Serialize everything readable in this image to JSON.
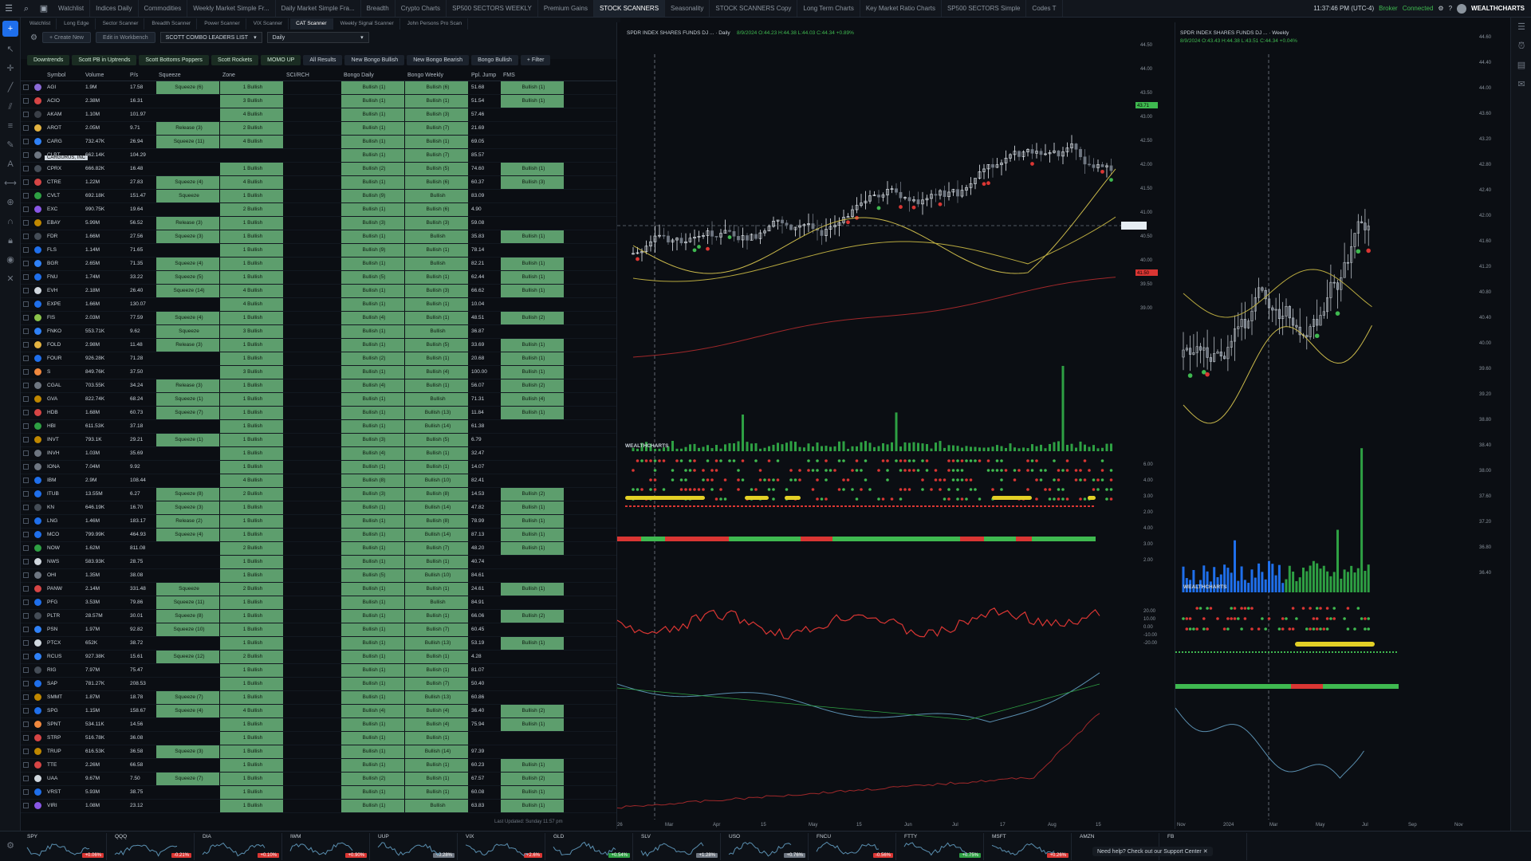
{
  "tabs": [
    "Watchlist",
    "Indices Daily",
    "Commodities",
    "Weekly Market Simple Fr...",
    "Daily Market Simple Fra...",
    "Breadth",
    "Crypto Charts",
    "SP500 SECTORS WEEKLY",
    "Premium Gains",
    "STOCK SCANNERS",
    "Seasonality",
    "STOCK SCANNERS Copy",
    "Long Term Charts",
    "Key Market Ratio Charts",
    "SP500 SECTORS Simple",
    "Codes T"
  ],
  "active_tab": "STOCK SCANNERS",
  "subtabs": [
    "Watchlist",
    "Long Edge",
    "Sector Scanner",
    "Breadth Scanner",
    "Power Scanner",
    "VIX Scanner",
    "CAT Scanner",
    "Weekly Signal Scanner",
    "John Persons Pro Scan"
  ],
  "status": {
    "time": "11:37:46 PM (UTC-4)",
    "broker": "Broker",
    "connected": "Connected",
    "brand": "WEALTHCHARTS"
  },
  "ws": {
    "btn1": "+ Create New",
    "btn2": "Edit in Workbench",
    "watchlist": "SCOTT COMBO LEADERS LIST",
    "interval": "Daily"
  },
  "filters": [
    "Downtrends",
    "Scott PB in Uptrends",
    "Scott Bottoms Poppers",
    "Scott Rockets",
    "MOMO UP",
    "All Results",
    "New Bongo Bullish",
    "New Bongo Bearish",
    "Bongo Bullish",
    "+ Filter"
  ],
  "columns": [
    "Symbol",
    "Volume",
    "P/s",
    "Squeeze",
    "Zone",
    "SCI/RCH",
    "Bongo Daily",
    "Bongo Weekly",
    "Ppl. Jump",
    "FMS"
  ],
  "tooltip": "CARGURUS, INC",
  "rows": [
    {
      "s": "AGI",
      "v": "1.9M",
      "p": "17.58",
      "q": "Squeeze (6)",
      "z": "1 Bullish",
      "d": "Bullish (1)",
      "w": "Bullish (6)",
      "j": "51.68",
      "f": "Bullish (1)",
      "c": "#8b6bd6"
    },
    {
      "s": "ACIO",
      "v": "2.38M",
      "p": "16.31",
      "q": "",
      "z": "3 Bullish",
      "d": "Bullish (1)",
      "w": "Bullish (1)",
      "j": "51.54",
      "f": "Bullish (1)",
      "c": "#d64545"
    },
    {
      "s": "AKAM",
      "v": "1.10M",
      "p": "101.97",
      "q": "",
      "z": "4 Bullish",
      "d": "Bullish (1)",
      "w": "Bullish (3)",
      "j": "57.46",
      "f": "",
      "c": "#3a3f47"
    },
    {
      "s": "AROT",
      "v": "2.05M",
      "p": "9.71",
      "q": "Release (3)",
      "z": "2 Bullish",
      "d": "Bullish (1)",
      "w": "Bullish (7)",
      "j": "21.69",
      "f": "",
      "c": "#e3b341"
    },
    {
      "s": "CARG",
      "v": "732.47K",
      "p": "26.94",
      "q": "Squeeze (11)",
      "z": "4 Bullish",
      "d": "Bullish (1)",
      "w": "Bullish (1)",
      "j": "69.05",
      "f": "",
      "c": "#2f81f7"
    },
    {
      "s": "CLBT",
      "v": "662.14K",
      "p": "104.29",
      "q": "",
      "z": "",
      "d": "Bullish (1)",
      "w": "Bullish (7)",
      "j": "85.57",
      "f": "",
      "c": "#6e7681"
    },
    {
      "s": "CPRX",
      "v": "666.82K",
      "p": "16.48",
      "q": "",
      "z": "1 Bullish",
      "d": "Bullish (2)",
      "w": "Bullish (5)",
      "j": "74.60",
      "f": "Bullish (1)",
      "c": "#444c56"
    },
    {
      "s": "CTRE",
      "v": "1.22M",
      "p": "27.83",
      "q": "Squeeze (4)",
      "z": "4 Bullish",
      "d": "Bullish (1)",
      "w": "Bullish (6)",
      "j": "60.37",
      "f": "Bullish (3)",
      "c": "#d64545"
    },
    {
      "s": "CVLT",
      "v": "692.18K",
      "p": "151.47",
      "q": "Squeeze",
      "z": "1 Bullish",
      "d": "Bullish (9)",
      "w": "Bullish",
      "j": "83.09",
      "f": "",
      "c": "#2ea043"
    },
    {
      "s": "EXC",
      "v": "990.75K",
      "p": "19.64",
      "q": "",
      "z": "2 Bullish",
      "d": "Bullish (1)",
      "w": "Bullish (6)",
      "j": "4.90",
      "f": "",
      "c": "#8957e5"
    },
    {
      "s": "EBAY",
      "v": "5.99M",
      "p": "56.52",
      "q": "Release (3)",
      "z": "1 Bullish",
      "d": "Bullish (3)",
      "w": "Bullish (3)",
      "j": "59.08",
      "f": "",
      "c": "#bf8700"
    },
    {
      "s": "FDR",
      "v": "1.66M",
      "p": "27.56",
      "q": "Squeeze (3)",
      "z": "1 Bullish",
      "d": "Bullish (1)",
      "w": "Bullish",
      "j": "35.83",
      "f": "Bullish (1)",
      "c": "#444c56"
    },
    {
      "s": "FLS",
      "v": "1.14M",
      "p": "71.65",
      "q": "",
      "z": "1 Bullish",
      "d": "Bullish (9)",
      "w": "Bullish (1)",
      "j": "78.14",
      "f": "",
      "c": "#1f6feb"
    },
    {
      "s": "BGR",
      "v": "2.65M",
      "p": "71.35",
      "q": "Squeeze (4)",
      "z": "1 Bullish",
      "d": "Bullish (1)",
      "w": "Bullish",
      "j": "82.21",
      "f": "Bullish (1)",
      "c": "#2f81f7"
    },
    {
      "s": "FNU",
      "v": "1.74M",
      "p": "33.22",
      "q": "Squeeze (5)",
      "z": "1 Bullish",
      "d": "Bullish (5)",
      "w": "Bullish (1)",
      "j": "62.44",
      "f": "Bullish (1)",
      "c": "#1f6feb"
    },
    {
      "s": "EVH",
      "v": "2.18M",
      "p": "26.40",
      "q": "Squeeze (14)",
      "z": "4 Bullish",
      "d": "Bullish (1)",
      "w": "Bullish (3)",
      "j": "66.62",
      "f": "Bullish (1)",
      "c": "#d0d7de"
    },
    {
      "s": "EXPE",
      "v": "1.66M",
      "p": "130.07",
      "q": "",
      "z": "4 Bullish",
      "d": "Bullish (1)",
      "w": "Bullish (1)",
      "j": "10.04",
      "f": "",
      "c": "#1f6feb"
    },
    {
      "s": "FIS",
      "v": "2.03M",
      "p": "77.59",
      "q": "Squeeze (4)",
      "z": "1 Bullish",
      "d": "Bullish (4)",
      "w": "Bullish (1)",
      "j": "48.51",
      "f": "Bullish (2)",
      "c": "#8bc34a"
    },
    {
      "s": "FNKO",
      "v": "553.71K",
      "p": "9.62",
      "q": "Squeeze",
      "z": "3 Bullish",
      "d": "Bullish (1)",
      "w": "Bullish",
      "j": "36.87",
      "f": "",
      "c": "#2f81f7"
    },
    {
      "s": "FOLD",
      "v": "2.98M",
      "p": "11.48",
      "q": "Release (3)",
      "z": "1 Bullish",
      "d": "Bullish (1)",
      "w": "Bullish (5)",
      "j": "33.69",
      "f": "Bullish (1)",
      "c": "#e3b341"
    },
    {
      "s": "FOUR",
      "v": "926.28K",
      "p": "71.28",
      "q": "",
      "z": "1 Bullish",
      "d": "Bullish (2)",
      "w": "Bullish (1)",
      "j": "20.68",
      "f": "Bullish (1)",
      "c": "#1f6feb"
    },
    {
      "s": "S",
      "v": "849.76K",
      "p": "37.50",
      "q": "",
      "z": "3 Bullish",
      "d": "Bullish (1)",
      "w": "Bullish (4)",
      "j": "100.00",
      "f": "Bullish (1)",
      "c": "#f0883e"
    },
    {
      "s": "CGAL",
      "v": "703.55K",
      "p": "34.24",
      "q": "Release (3)",
      "z": "1 Bullish",
      "d": "Bullish (4)",
      "w": "Bullish (1)",
      "j": "56.07",
      "f": "Bullish (2)",
      "c": "#6e7681"
    },
    {
      "s": "GVA",
      "v": "822.74K",
      "p": "68.24",
      "q": "Squeeze (1)",
      "z": "1 Bullish",
      "d": "Bullish (1)",
      "w": "Bullish",
      "j": "71.31",
      "f": "Bullish (4)",
      "c": "#bf8700"
    },
    {
      "s": "HDB",
      "v": "1.68M",
      "p": "60.73",
      "q": "Squeeze (7)",
      "z": "1 Bullish",
      "d": "Bullish (1)",
      "w": "Bullish (13)",
      "j": "11.84",
      "f": "Bullish (1)",
      "c": "#d64545"
    },
    {
      "s": "HBI",
      "v": "611.53K",
      "p": "37.18",
      "q": "",
      "z": "1 Bullish",
      "d": "Bullish (1)",
      "w": "Bullish (14)",
      "j": "61.38",
      "f": "",
      "c": "#2ea043"
    },
    {
      "s": "INVT",
      "v": "793.1K",
      "p": "29.21",
      "q": "Squeeze (1)",
      "z": "1 Bullish",
      "d": "Bullish (3)",
      "w": "Bullish (5)",
      "j": "6.79",
      "f": "",
      "c": "#bf8700"
    },
    {
      "s": "INVH",
      "v": "1.03M",
      "p": "35.69",
      "q": "",
      "z": "1 Bullish",
      "d": "Bullish (4)",
      "w": "Bullish (1)",
      "j": "32.47",
      "f": "",
      "c": "#6e7681"
    },
    {
      "s": "IONA",
      "v": "7.04M",
      "p": "9.92",
      "q": "",
      "z": "1 Bullish",
      "d": "Bullish (1)",
      "w": "Bullish (1)",
      "j": "14.07",
      "f": "",
      "c": "#6e7681"
    },
    {
      "s": "IBM",
      "v": "2.9M",
      "p": "108.44",
      "q": "",
      "z": "4 Bullish",
      "d": "Bullish (8)",
      "w": "Bullish (10)",
      "j": "82.41",
      "f": "",
      "c": "#1f6feb"
    },
    {
      "s": "ITUB",
      "v": "13.55M",
      "p": "6.27",
      "q": "Squeeze (8)",
      "z": "2 Bullish",
      "d": "Bullish (3)",
      "w": "Bullish (8)",
      "j": "14.53",
      "f": "Bullish (2)",
      "c": "#1f6feb"
    },
    {
      "s": "KN",
      "v": "646.19K",
      "p": "16.70",
      "q": "Squeeze (3)",
      "z": "1 Bullish",
      "d": "Bullish (1)",
      "w": "Bullish (14)",
      "j": "47.82",
      "f": "Bullish (1)",
      "c": "#444c56"
    },
    {
      "s": "LNG",
      "v": "1.46M",
      "p": "183.17",
      "q": "Release (2)",
      "z": "1 Bullish",
      "d": "Bullish (1)",
      "w": "Bullish (8)",
      "j": "78.99",
      "f": "Bullish (1)",
      "c": "#1f6feb"
    },
    {
      "s": "MCO",
      "v": "799.99K",
      "p": "464.93",
      "q": "Squeeze (4)",
      "z": "1 Bullish",
      "d": "Bullish (1)",
      "w": "Bullish (14)",
      "j": "87.13",
      "f": "Bullish (1)",
      "c": "#1f6feb"
    },
    {
      "s": "NOW",
      "v": "1.62M",
      "p": "811.08",
      "q": "",
      "z": "2 Bullish",
      "d": "Bullish (1)",
      "w": "Bullish (7)",
      "j": "48.20",
      "f": "Bullish (1)",
      "c": "#2ea043"
    },
    {
      "s": "NWS",
      "v": "583.93K",
      "p": "28.75",
      "q": "",
      "z": "1 Bullish",
      "d": "Bullish (1)",
      "w": "Bullish (1)",
      "j": "40.74",
      "f": "",
      "c": "#d0d7de"
    },
    {
      "s": "OHI",
      "v": "1.35M",
      "p": "38.08",
      "q": "",
      "z": "1 Bullish",
      "d": "Bullish (5)",
      "w": "Bullish (10)",
      "j": "84.61",
      "f": "",
      "c": "#6e7681"
    },
    {
      "s": "PANW",
      "v": "2.14M",
      "p": "331.48",
      "q": "Squeeze",
      "z": "2 Bullish",
      "d": "Bullish (1)",
      "w": "Bullish (1)",
      "j": "24.61",
      "f": "Bullish (1)",
      "c": "#d64545"
    },
    {
      "s": "PFG",
      "v": "3.53M",
      "p": "79.86",
      "q": "Squeeze (11)",
      "z": "1 Bullish",
      "d": "Bullish (1)",
      "w": "Bullish",
      "j": "84.91",
      "f": "",
      "c": "#1f6feb"
    },
    {
      "s": "PLTR",
      "v": "28.57M",
      "p": "30.01",
      "q": "Squeeze (8)",
      "z": "1 Bullish",
      "d": "Bullish (1)",
      "w": "Bullish (1)",
      "j": "66.06",
      "f": "Bullish (2)",
      "c": "#444c56"
    },
    {
      "s": "PSN",
      "v": "1.97M",
      "p": "92.82",
      "q": "Squeeze (10)",
      "z": "1 Bullish",
      "d": "Bullish (1)",
      "w": "Bullish (7)",
      "j": "60.45",
      "f": "",
      "c": "#2f81f7"
    },
    {
      "s": "PTCX",
      "v": "652K",
      "p": "38.72",
      "q": "",
      "z": "1 Bullish",
      "d": "Bullish (1)",
      "w": "Bullish (13)",
      "j": "53.19",
      "f": "Bullish (1)",
      "c": "#d0d7de"
    },
    {
      "s": "RCUS",
      "v": "927.38K",
      "p": "15.61",
      "q": "Squeeze (12)",
      "z": "2 Bullish",
      "d": "Bullish (1)",
      "w": "Bullish (1)",
      "j": "4.28",
      "f": "",
      "c": "#2f81f7"
    },
    {
      "s": "RIG",
      "v": "7.97M",
      "p": "75.47",
      "q": "",
      "z": "1 Bullish",
      "d": "Bullish (1)",
      "w": "Bullish (1)",
      "j": "81.07",
      "f": "",
      "c": "#444c56"
    },
    {
      "s": "SAP",
      "v": "781.27K",
      "p": "208.53",
      "q": "",
      "z": "1 Bullish",
      "d": "Bullish (1)",
      "w": "Bullish (7)",
      "j": "50.40",
      "f": "",
      "c": "#1f6feb"
    },
    {
      "s": "SMMT",
      "v": "1.87M",
      "p": "18.78",
      "q": "Squeeze (7)",
      "z": "1 Bullish",
      "d": "Bullish (1)",
      "w": "Bullish (13)",
      "j": "60.86",
      "f": "",
      "c": "#bf8700"
    },
    {
      "s": "SPG",
      "v": "1.15M",
      "p": "158.67",
      "q": "Squeeze (4)",
      "z": "4 Bullish",
      "d": "Bullish (4)",
      "w": "Bullish (4)",
      "j": "36.40",
      "f": "Bullish (2)",
      "c": "#1f6feb"
    },
    {
      "s": "SPNT",
      "v": "534.11K",
      "p": "14.56",
      "q": "",
      "z": "1 Bullish",
      "d": "Bullish (1)",
      "w": "Bullish (4)",
      "j": "75.94",
      "f": "Bullish (1)",
      "c": "#f0883e"
    },
    {
      "s": "STRP",
      "v": "516.78K",
      "p": "36.08",
      "q": "",
      "z": "1 Bullish",
      "d": "Bullish (1)",
      "w": "Bullish (1)",
      "j": "",
      "f": "",
      "c": "#d64545"
    },
    {
      "s": "TRUP",
      "v": "616.53K",
      "p": "36.58",
      "q": "Squeeze (3)",
      "z": "1 Bullish",
      "d": "Bullish (1)",
      "w": "Bullish (14)",
      "j": "97.39",
      "f": "",
      "c": "#bf8700"
    },
    {
      "s": "TTE",
      "v": "2.26M",
      "p": "66.58",
      "q": "",
      "z": "1 Bullish",
      "d": "Bullish (1)",
      "w": "Bullish (1)",
      "j": "60.23",
      "f": "Bullish (1)",
      "c": "#d64545"
    },
    {
      "s": "UAA",
      "v": "9.67M",
      "p": "7.50",
      "q": "Squeeze (7)",
      "z": "1 Bullish",
      "d": "Bullish (2)",
      "w": "Bullish (1)",
      "j": "67.57",
      "f": "Bullish (2)",
      "c": "#d0d7de"
    },
    {
      "s": "VRST",
      "v": "5.93M",
      "p": "38.75",
      "q": "",
      "z": "1 Bullish",
      "d": "Bullish (1)",
      "w": "Bullish (1)",
      "j": "60.08",
      "f": "Bullish (1)",
      "c": "#1f6feb"
    },
    {
      "s": "VIRI",
      "v": "1.08M",
      "p": "23.12",
      "q": "",
      "z": "1 Bullish",
      "d": "Bullish (1)",
      "w": "Bullish",
      "j": "63.83",
      "f": "Bullish (1)",
      "c": "#8957e5"
    }
  ],
  "table_footer": "Last Updated: Sunday 11:57 pm",
  "chart_main": {
    "title": "SPDR INDEX SHARES FUNDS DJ ... · Daily",
    "ohlc": "8/9/2024 O:44.23 H:44.38 L:44.03 C:44.34 +0.89%",
    "x_labels": [
      "26",
      "Mar",
      "Apr",
      "15",
      "May",
      "15",
      "Jun",
      "Jul",
      "17",
      "Aug",
      "15"
    ],
    "y_labels": [
      "44.50",
      "44.00",
      "43.50",
      "43.00",
      "42.50",
      "42.00",
      "41.50",
      "41.00",
      "40.50",
      "40.00",
      "39.50",
      "39.00"
    ],
    "tag": "43.71",
    "tag2": "41.50",
    "brand": "WEALTHCHARTS",
    "osc_labels": [
      "6.00",
      "4.00",
      "3.00",
      "2.00",
      "4.00",
      "3.00",
      "2.00"
    ],
    "rsi_labels": [
      "20.00",
      "10.00",
      "0.00",
      "-10.00",
      "-20.00"
    ]
  },
  "chart_weekly": {
    "title": "SPDR INDEX SHARES FUNDS DJ ... · Weekly",
    "ohlc": "8/9/2024 O:43.43 H:44.38 L:43.51 C:44.34 +0.04%",
    "x_labels": [
      "Nov",
      "2024",
      "Mar",
      "May",
      "Jul",
      "Sep",
      "Nov"
    ],
    "y_labels": [
      "44.60",
      "44.40",
      "44.00",
      "43.60",
      "43.20",
      "42.80",
      "42.40",
      "42.00",
      "41.60",
      "41.20",
      "40.80",
      "40.40",
      "40.00",
      "39.60",
      "39.20",
      "38.80",
      "38.40",
      "38.00",
      "37.60",
      "37.20",
      "36.80",
      "36.40"
    ],
    "brand": "WEALTHCHARTS"
  },
  "bottom_tickers": [
    {
      "s": "SPY",
      "p": "+0.06%",
      "c": "#da3633"
    },
    {
      "s": "QQQ",
      "p": "-0.21%",
      "c": "#da3633"
    },
    {
      "s": "DIA",
      "p": "+0.10%",
      "c": "#da3633"
    },
    {
      "s": "IWM",
      "p": "+0.90%",
      "c": "#da3633"
    },
    {
      "s": "UUP",
      "p": "+0.28%",
      "c": "#6e7681"
    },
    {
      "s": "VIX",
      "p": "+2.6%",
      "c": "#da3633"
    },
    {
      "s": "GLD",
      "p": "+0.54%",
      "c": "#2ea043"
    },
    {
      "s": "SLV",
      "p": "+1.28%",
      "c": "#6e7681"
    },
    {
      "s": "USO",
      "p": "+0.76%",
      "c": "#6e7681"
    },
    {
      "s": "FNCU",
      "p": "-0.56%",
      "c": "#da3633"
    },
    {
      "s": "FTTY",
      "p": "+0.75%",
      "c": "#2ea043"
    },
    {
      "s": "MSFT",
      "p": "+0.26%",
      "c": "#da3633"
    },
    {
      "s": "AMZN",
      "p": "",
      "c": "#6e7681"
    },
    {
      "s": "FB",
      "p": "",
      "c": "#6e7681"
    }
  ],
  "support_msg": "Need help? Check out our Support Center"
}
